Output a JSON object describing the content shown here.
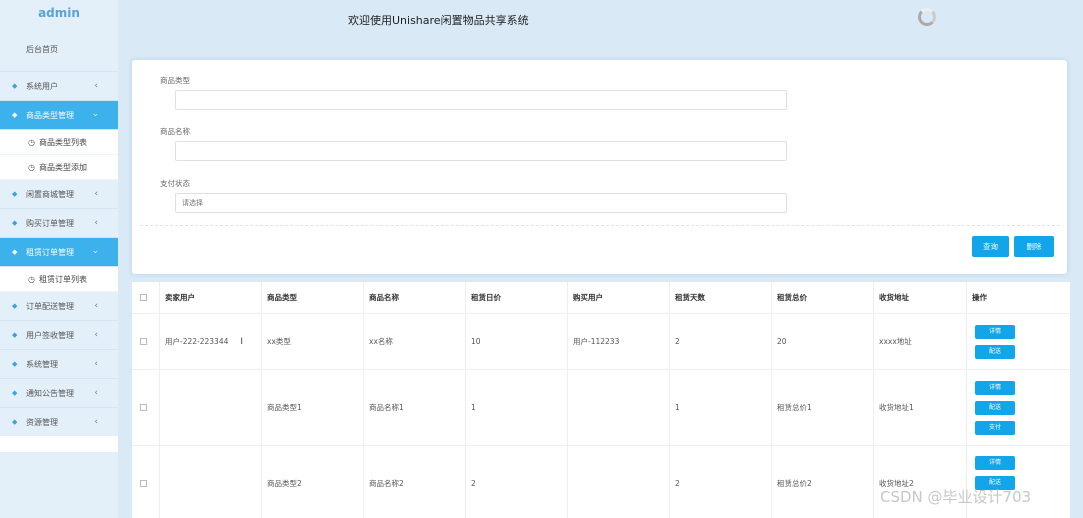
{
  "sidebar": {
    "brand": "admin",
    "home": "后台首页",
    "items": [
      {
        "label": "系统用户",
        "active": false
      },
      {
        "label": "商品类型管理",
        "active": true,
        "children": [
          "商品类型列表",
          "商品类型添加"
        ]
      },
      {
        "label": "闲置商城管理",
        "active": false
      },
      {
        "label": "购买订单管理",
        "active": false
      },
      {
        "label": "租赁订单管理",
        "active": true,
        "children": [
          "租赁订单列表"
        ]
      },
      {
        "label": "订单配送管理",
        "active": false
      },
      {
        "label": "用户签收管理",
        "active": false
      },
      {
        "label": "系统管理",
        "active": false
      },
      {
        "label": "通知公告管理",
        "active": false
      },
      {
        "label": "资源管理",
        "active": false
      }
    ]
  },
  "header": {
    "title": "欢迎使用Unishare闲置物品共享系统"
  },
  "search": {
    "fields": [
      {
        "label": "商品类型",
        "value": "",
        "placeholder": ""
      },
      {
        "label": "商品名称",
        "value": "",
        "placeholder": ""
      },
      {
        "label": "支付状态",
        "value": "",
        "placeholder": "请选择"
      }
    ],
    "query_label": "查询",
    "delete_label": "删除"
  },
  "table": {
    "headers": [
      "卖家用户",
      "商品类型",
      "商品名称",
      "租赁日价",
      "购买用户",
      "租赁天数",
      "租赁总价",
      "收货地址",
      "操作"
    ],
    "rows": [
      {
        "cells": [
          "用户-222-223344",
          "xx类型",
          "xx名称",
          "10",
          "用户-112233",
          "2",
          "20",
          "xxxx地址"
        ],
        "ops": [
          "详情",
          "配送"
        ]
      },
      {
        "cells": [
          "",
          "商品类型1",
          "商品名称1",
          "1",
          "",
          "1",
          "租赁总价1",
          "收货地址1"
        ],
        "ops": [
          "详情",
          "配送",
          "支付"
        ]
      },
      {
        "cells": [
          "",
          "商品类型2",
          "商品名称2",
          "2",
          "",
          "2",
          "租赁总价2",
          "收货地址2"
        ],
        "ops": [
          "详情",
          "配送"
        ]
      }
    ]
  },
  "watermark": "CSDN @毕业设计703",
  "colors": {
    "accent": "#12a5ea",
    "sidebar_active": "#3db1ec",
    "background": "#d9e9f5"
  }
}
